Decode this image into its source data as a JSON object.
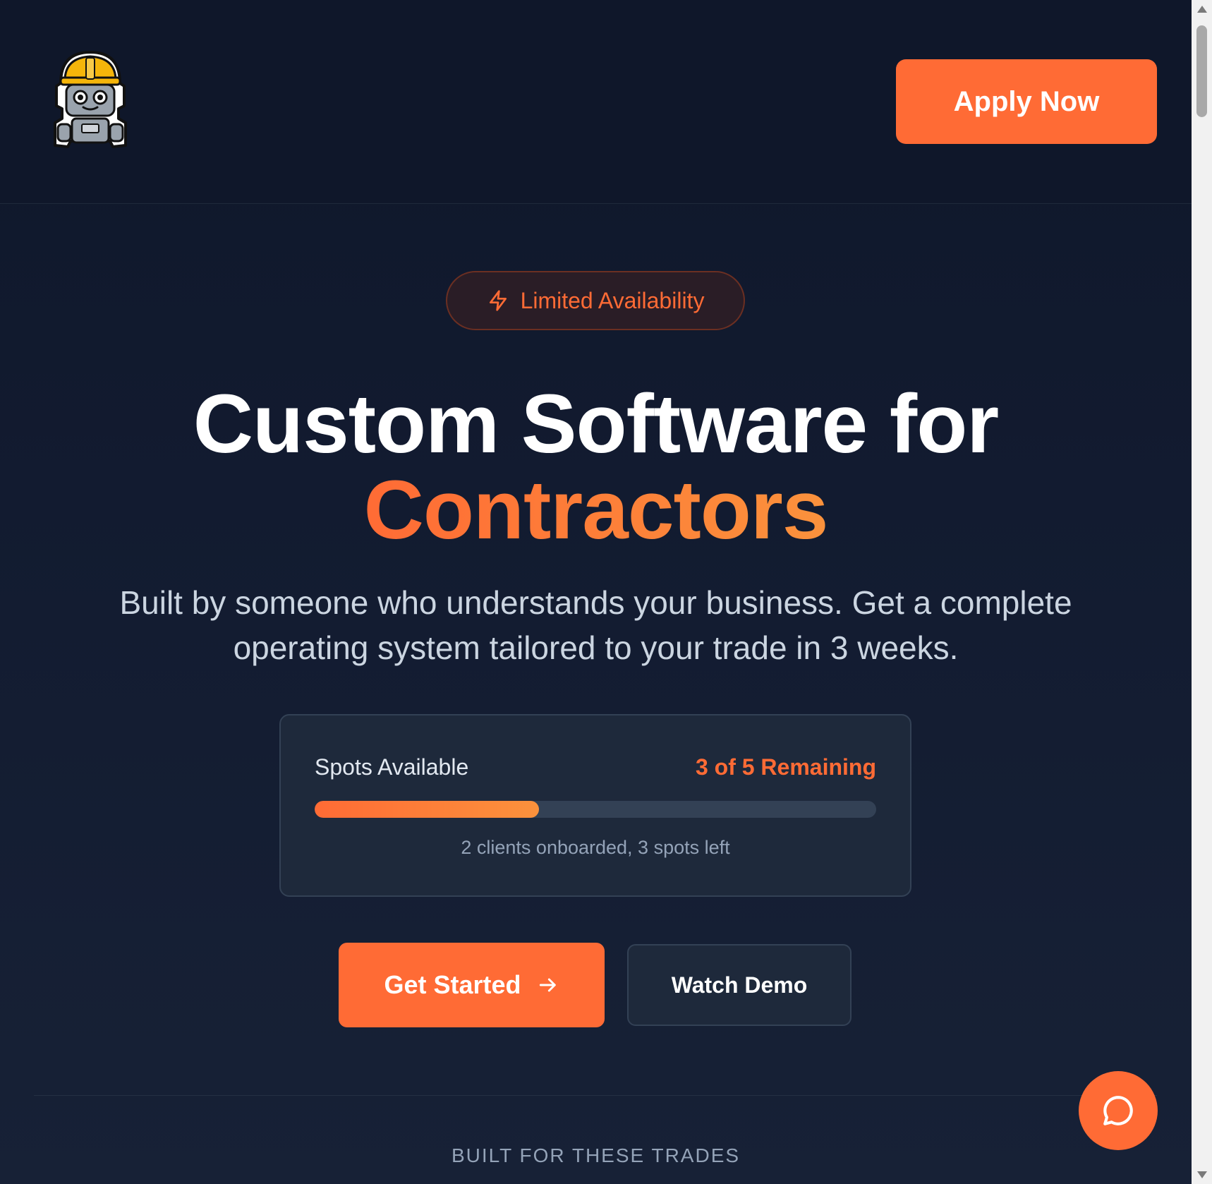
{
  "header": {
    "logo_icon": "construction-robot-logo",
    "apply_label": "Apply Now"
  },
  "hero": {
    "badge_icon": "lightning-bolt-icon",
    "badge_text": "Limited Availability",
    "headline_line1": "Custom Software for",
    "headline_line2": "Contractors",
    "subtitle": "Built by someone who understands your business. Get a complete operating system tailored to your trade in 3 weeks."
  },
  "spots": {
    "label": "Spots Available",
    "count_text": "3 of 5 Remaining",
    "progress_fraction": 0.4,
    "note": "2 clients onboarded, 3 spots left"
  },
  "cta": {
    "primary_label": "Get Started",
    "primary_icon": "arrow-right-icon",
    "secondary_label": "Watch Demo"
  },
  "trades": {
    "section_label": "BUILT FOR THESE TRADES"
  },
  "chat": {
    "icon": "chat-bubble-icon"
  },
  "colors": {
    "accent": "#ff6b35",
    "accent_light": "#fb923c",
    "background": "#0f172a",
    "card": "#1e293b"
  }
}
